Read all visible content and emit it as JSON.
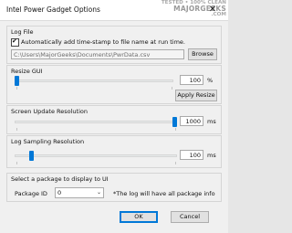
{
  "window": {
    "title": "Intel Power Gadget Options",
    "close_glyph": "✕"
  },
  "watermark": {
    "line1": "TESTED • 100% CLEAN",
    "line2": "MAJORGEEKS",
    "line3": ".COM"
  },
  "log_file": {
    "group_label": "Log File",
    "checkbox_label": "Automatically add time-stamp to file name at run time.",
    "checked": true,
    "path_value": "C:\\Users\\MajorGeeks\\Documents\\PwrData.csv",
    "browse_label": "Browse"
  },
  "resize_gui": {
    "group_label": "Resize GUI",
    "slider_value": 100,
    "slider_fraction": 0.0,
    "unit": "%",
    "apply_label": "Apply Resize"
  },
  "screen_update": {
    "group_label": "Screen Update Resolution",
    "slider_value": 1000,
    "slider_fraction": 1.0,
    "unit": "ms"
  },
  "log_sampling": {
    "group_label": "Log Sampling Resolution",
    "slider_value": 100,
    "slider_fraction": 0.09,
    "unit": "ms"
  },
  "package": {
    "group_label": "Select a package to display to UI",
    "id_label": "Package ID",
    "selected": "0",
    "note": "*The log will have all package info"
  },
  "buttons": {
    "ok": "OK",
    "cancel": "Cancel"
  },
  "colors": {
    "accent": "#0078d7",
    "dialog_bg": "#f0f0f0",
    "border": "#d5d5d5"
  }
}
